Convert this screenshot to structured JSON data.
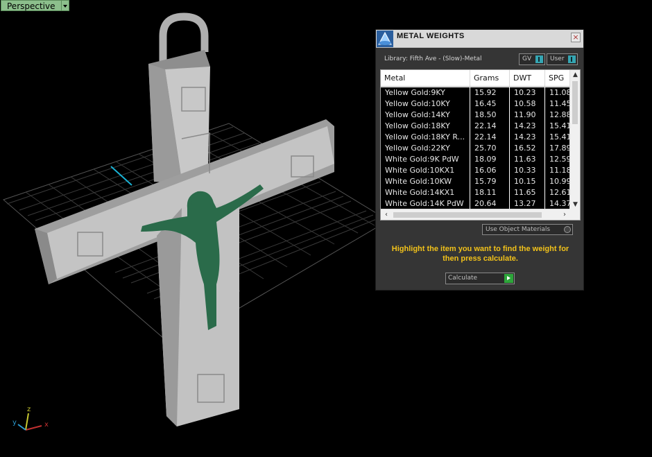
{
  "viewport": {
    "label": "Perspective",
    "axis_x": "x",
    "axis_y": "y",
    "axis_z": "z"
  },
  "panel": {
    "title": "METAL WEIGHTS",
    "close_label": "×",
    "library": "Library: Fifth Ave - (Slow)-Metal",
    "gv_label": "GV",
    "user_label": "User",
    "columns": [
      "Metal",
      "Grams",
      "DWT",
      "SPG"
    ],
    "rows": [
      [
        "Yellow Gold:9KY",
        "15.92",
        "10.23",
        "11.08"
      ],
      [
        "Yellow Gold:10KY",
        "16.45",
        "10.58",
        "11.45"
      ],
      [
        "Yellow Gold:14KY",
        "18.50",
        "11.90",
        "12.88"
      ],
      [
        "Yellow Gold:18KY",
        "22.14",
        "14.23",
        "15.41"
      ],
      [
        "Yellow Gold:18KY R...",
        "22.14",
        "14.23",
        "15.41"
      ],
      [
        "Yellow Gold:22KY",
        "25.70",
        "16.52",
        "17.89"
      ],
      [
        "White Gold:9K PdW",
        "18.09",
        "11.63",
        "12.59"
      ],
      [
        "White Gold:10KX1",
        "16.06",
        "10.33",
        "11.18"
      ],
      [
        "White Gold:10KW",
        "15.79",
        "10.15",
        "10.99"
      ],
      [
        "White Gold:14KX1",
        "18.11",
        "11.65",
        "12.61"
      ],
      [
        "White Gold:14K PdW",
        "20.64",
        "13.27",
        "14.37"
      ]
    ],
    "use_object_materials": "Use Object Materials",
    "hint": "Highlight the item you want to find the weight for then press calculate.",
    "calculate_label": "Calculate"
  }
}
